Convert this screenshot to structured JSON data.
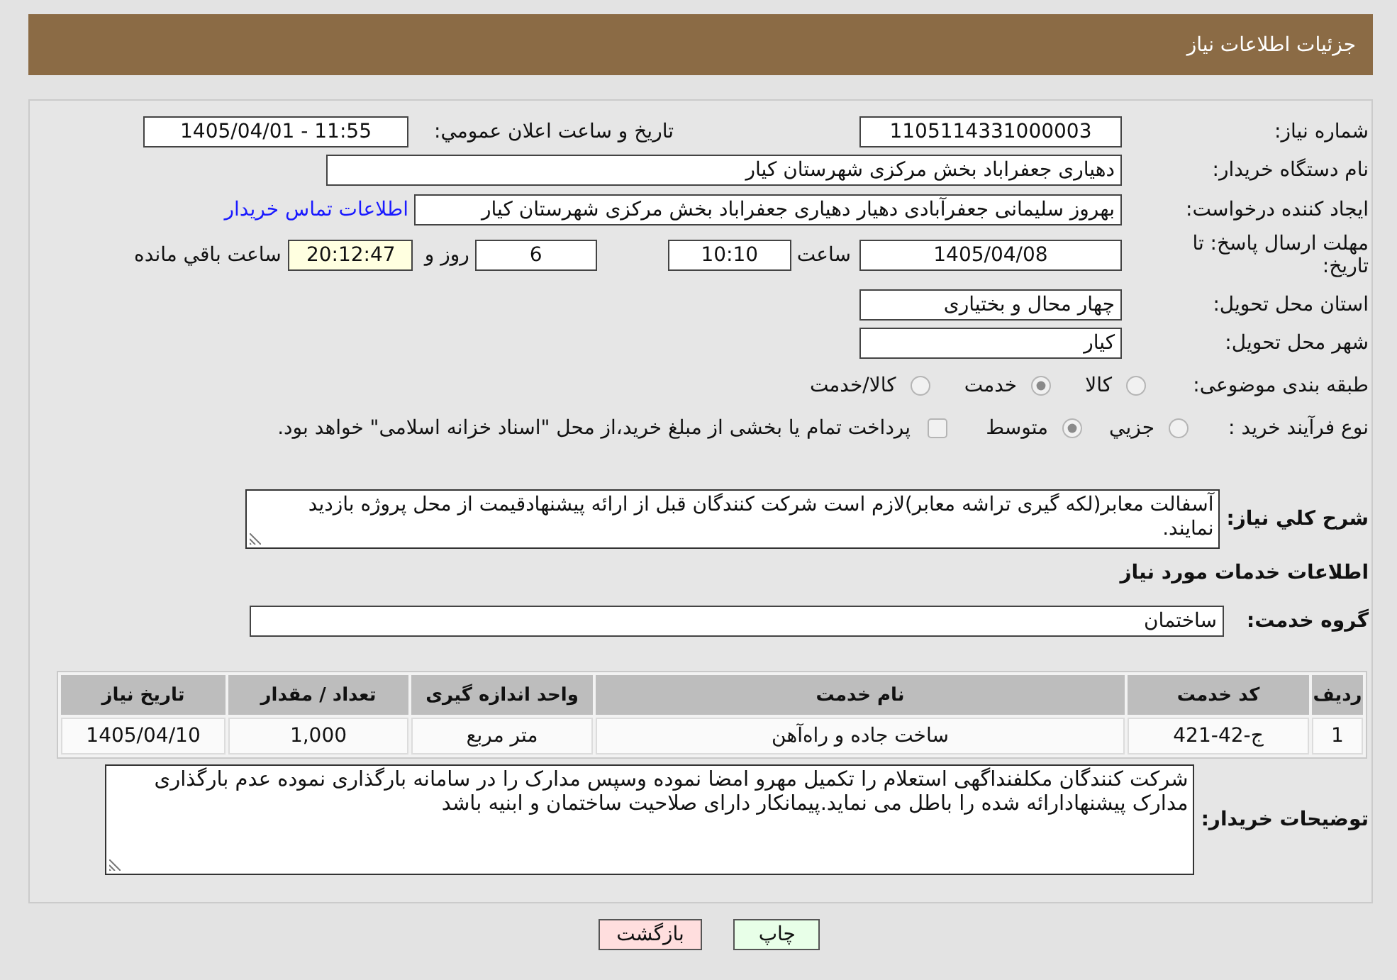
{
  "header": {
    "title": "جزئیات اطلاعات نیاز"
  },
  "need_number": {
    "label": "شماره نیاز:",
    "value": "1105114331000003"
  },
  "announcement": {
    "label": "تاریخ و ساعت اعلان عمومي:",
    "value": "1405/04/01 - 11:55"
  },
  "buyer_org": {
    "label": "نام دستگاه خریدار:",
    "value": "دهیاری جعفراباد بخش مرکزی شهرستان کیار"
  },
  "requester": {
    "label": "ایجاد کننده درخواست:",
    "value": "بهروز سلیمانی جعفرآبادی دهیار دهیاری جعفراباد بخش مرکزی شهرستان کیار",
    "link": "اطلاعات تماس خریدار"
  },
  "deadline": {
    "label": "مهلت ارسال پاسخ: تا تاریخ:",
    "date": "1405/04/08",
    "time_label": "ساعت",
    "time": "10:10",
    "days": "6",
    "days_label": "روز و",
    "remaining": "20:12:47",
    "remaining_label": "ساعت باقي مانده"
  },
  "province": {
    "label": "استان محل تحویل:",
    "value": "چهار محال و بختیاری"
  },
  "city": {
    "label": "شهر محل تحویل:",
    "value": "کیار"
  },
  "category": {
    "label": "طبقه بندی موضوعی:",
    "options": [
      {
        "label": "کالا",
        "selected": false
      },
      {
        "label": "خدمت",
        "selected": true
      },
      {
        "label": "کالا/خدمت",
        "selected": false
      }
    ]
  },
  "process": {
    "label": "نوع فرآیند خرید :",
    "options": [
      {
        "label": "جزيي",
        "selected": false
      },
      {
        "label": "متوسط",
        "selected": true
      }
    ],
    "treasury": {
      "checked": false,
      "text": "پرداخت تمام یا بخشی از مبلغ خرید،از محل \"اسناد خزانه اسلامی\" خواهد بود."
    }
  },
  "description": {
    "label": "شرح كلي نياز:",
    "value": "آسفالت معابر(لکه گیری تراشه معابر)لازم است شرکت کنندگان قبل از ارائه پیشنهادقیمت از محل پروژه بازدید نمایند."
  },
  "services_heading": "اطلاعات خدمات مورد نیاز",
  "service_group": {
    "label": "گروه خدمت:",
    "value": "ساختمان"
  },
  "table": {
    "columns": [
      "ردیف",
      "کد خدمت",
      "نام خدمت",
      "واحد اندازه گیری",
      "تعداد / مقدار",
      "تاریخ نیاز"
    ],
    "rows": [
      [
        "1",
        "ج-42-421",
        "ساخت جاده و راه‌آهن",
        "متر مربع",
        "1,000",
        "1405/04/10"
      ]
    ]
  },
  "buyer_notes": {
    "label": "توضیحات خریدار:",
    "value": "شرکت کنندگان مکلفنداگهی استعلام را تکمیل مهرو امضا نموده وسپس مدارک را در سامانه بارگذاری نموده عدم بارگذاری مدارک پیشنهادارائه شده را باطل می نماید.پیمانکار دارای صلاحیت ساختمان و ابنیه باشد"
  },
  "buttons": [
    {
      "label": "چاپ",
      "kind": "print"
    },
    {
      "label": "بازگشت",
      "kind": "back"
    }
  ]
}
